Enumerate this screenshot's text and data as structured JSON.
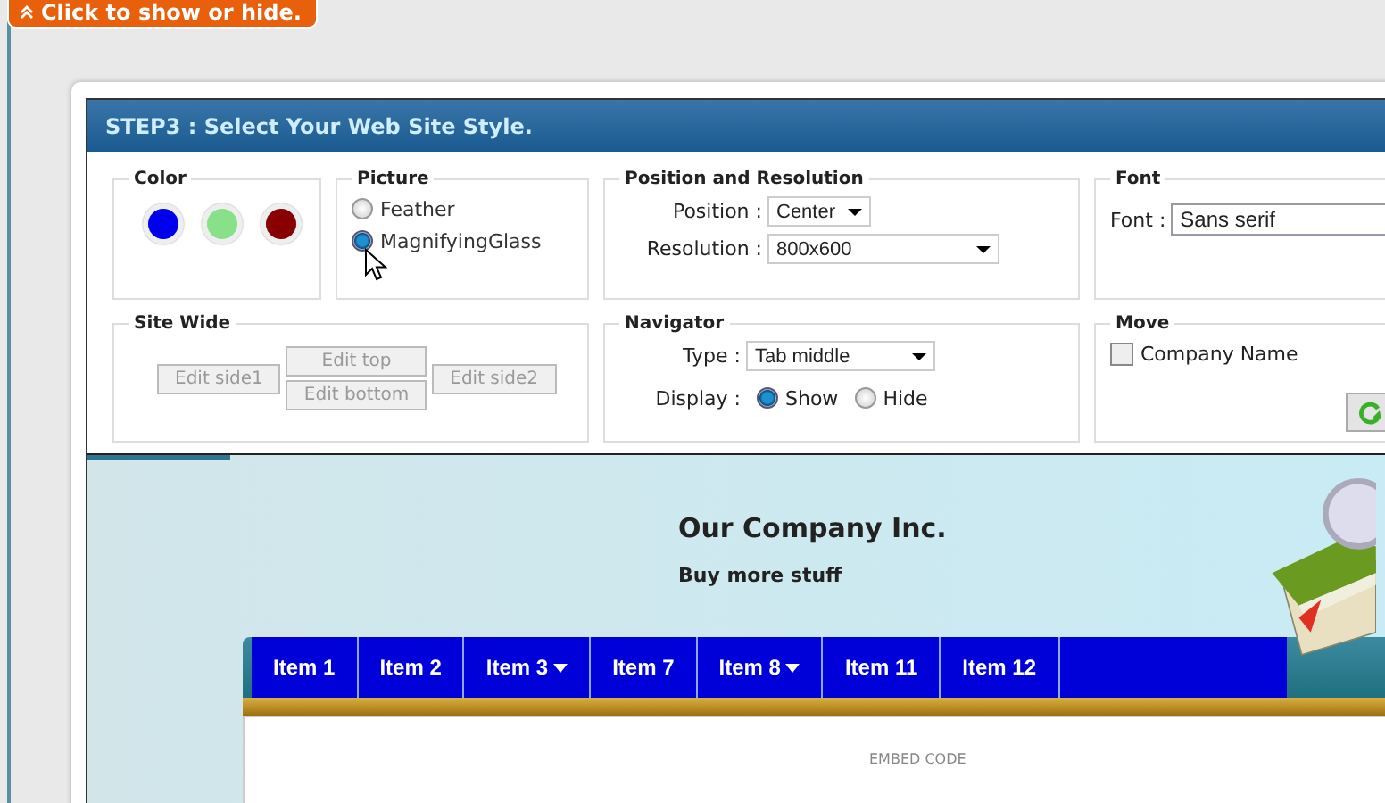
{
  "toggle_tab": {
    "label": "Click to show or hide."
  },
  "dialog": {
    "title": "STEP3 : Select Your Web Site Style."
  },
  "color": {
    "legend": "Color",
    "swatches": [
      {
        "color": "#0000ee"
      },
      {
        "color": "#88e088"
      },
      {
        "color": "#880000"
      }
    ]
  },
  "picture": {
    "legend": "Picture",
    "options": [
      {
        "label": "Feather",
        "selected": false
      },
      {
        "label": "MagnifyingGlass",
        "selected": true
      }
    ]
  },
  "position_resolution": {
    "legend": "Position and Resolution",
    "position": {
      "label": "Position :",
      "value": "Center"
    },
    "resolution": {
      "label": "Resolution :",
      "value": "800x600"
    }
  },
  "font": {
    "legend": "Font",
    "label": "Font :",
    "value": "Sans serif"
  },
  "site_wide": {
    "legend": "Site Wide",
    "buttons": [
      "Edit side1",
      "Edit top",
      "Edit bottom",
      "Edit side2"
    ]
  },
  "navigator": {
    "legend": "Navigator",
    "type": {
      "label": "Type :",
      "value": "Tab middle"
    },
    "display": {
      "label": "Display :",
      "options": [
        {
          "label": "Show",
          "selected": true
        },
        {
          "label": "Hide",
          "selected": false
        }
      ]
    }
  },
  "move": {
    "legend": "Move",
    "options": [
      {
        "label": "Company Name",
        "checked": false
      }
    ]
  },
  "preview": {
    "company": "Our Company Inc.",
    "tagline": "Buy more stuff",
    "menu": [
      {
        "label": "Item 1",
        "has_submenu": false
      },
      {
        "label": "Item 2",
        "has_submenu": false
      },
      {
        "label": "Item 3",
        "has_submenu": true
      },
      {
        "label": "Item 7",
        "has_submenu": false
      },
      {
        "label": "Item 8",
        "has_submenu": true
      },
      {
        "label": "Item 11",
        "has_submenu": false
      },
      {
        "label": "Item 12",
        "has_submenu": false
      }
    ],
    "embed_label": "EMBED CODE"
  }
}
